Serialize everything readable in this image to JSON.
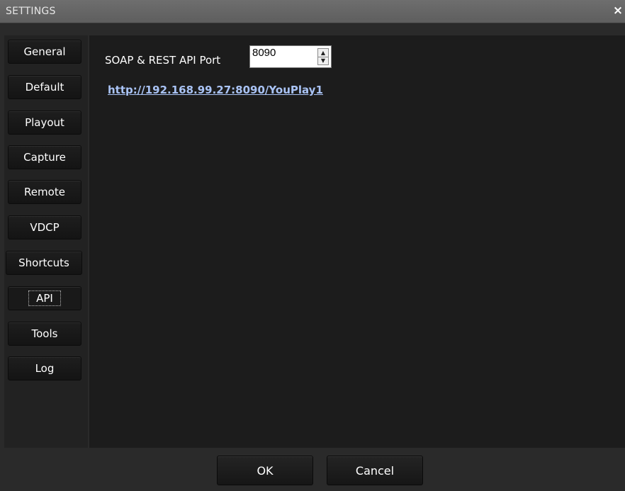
{
  "window": {
    "title": "SETTINGS",
    "close_glyph": "×"
  },
  "sidebar": {
    "items": [
      {
        "label": "General"
      },
      {
        "label": "Default"
      },
      {
        "label": "Playout"
      },
      {
        "label": "Capture"
      },
      {
        "label": "Remote"
      },
      {
        "label": "VDCP"
      },
      {
        "label": "Shortcuts"
      },
      {
        "label": "API",
        "selected": true
      },
      {
        "label": "Tools"
      },
      {
        "label": "Log"
      }
    ]
  },
  "api": {
    "port_label": "SOAP & REST API Port",
    "port_value": "8090",
    "url": "http://192.168.99.27:8090/YouPlay1"
  },
  "footer": {
    "ok_label": "OK",
    "cancel_label": "Cancel"
  },
  "icons": {
    "close": "close-icon",
    "spin_up": "up-arrow-icon",
    "spin_down": "down-arrow-icon"
  },
  "colors": {
    "link": "#a9c3f5",
    "background": "#1c1c1c"
  }
}
